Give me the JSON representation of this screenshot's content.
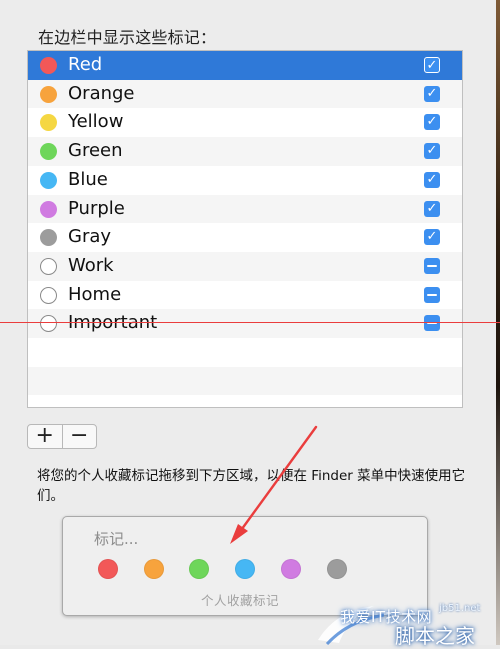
{
  "header": {
    "label": "在边栏中显示这些标记："
  },
  "tags": [
    {
      "name": "Red",
      "color": "#f25858",
      "state": "checked",
      "selected": true
    },
    {
      "name": "Orange",
      "color": "#f7a33d",
      "state": "checked",
      "selected": false
    },
    {
      "name": "Yellow",
      "color": "#f5d743",
      "state": "checked",
      "selected": false
    },
    {
      "name": "Green",
      "color": "#6ed65a",
      "state": "checked",
      "selected": false
    },
    {
      "name": "Blue",
      "color": "#46b7f4",
      "state": "checked",
      "selected": false
    },
    {
      "name": "Purple",
      "color": "#d07be1",
      "state": "checked",
      "selected": false
    },
    {
      "name": "Gray",
      "color": "#9c9c9c",
      "state": "checked",
      "selected": false
    },
    {
      "name": "Work",
      "color": "",
      "state": "mixed",
      "selected": false
    },
    {
      "name": "Home",
      "color": "",
      "state": "mixed",
      "selected": false
    },
    {
      "name": "Important",
      "color": "",
      "state": "mixed",
      "selected": false
    }
  ],
  "controls": {
    "add_label": "+",
    "remove_label": "−"
  },
  "instructions": {
    "text": "将您的个人收藏标记拖移到下方区域，以便在 Finder 菜单中快速使用它们。"
  },
  "favorites": {
    "title": "标记...",
    "caption": "个人收藏标记",
    "colors": [
      "#f25858",
      "#f7a33d",
      "#6ed65a",
      "#46b7f4",
      "#d07be1",
      "#9c9c9c"
    ]
  },
  "annotation": {
    "line_color": "#ea3d3d",
    "arrow_color": "#ea3d3d"
  },
  "watermark": {
    "main": "我爱IT技术网",
    "site": "jb51.net",
    "brand": "脚本之家"
  }
}
